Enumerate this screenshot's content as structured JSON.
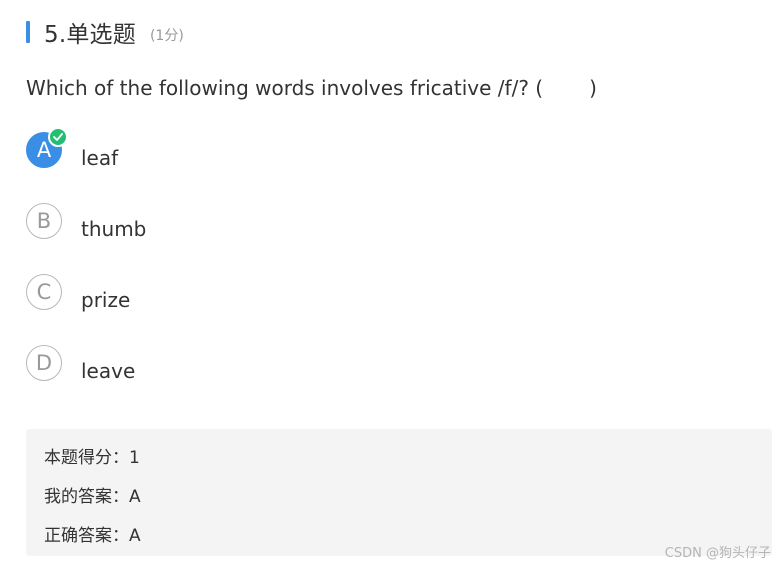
{
  "question": {
    "title": "5.单选题",
    "score_note": "(1分)",
    "text": "Which of the following words involves fricative /f/? (",
    "text_end": ")"
  },
  "options": [
    {
      "letter": "A",
      "text": "leaf",
      "selected": true
    },
    {
      "letter": "B",
      "text": "thumb",
      "selected": false
    },
    {
      "letter": "C",
      "text": "prize",
      "selected": false
    },
    {
      "letter": "D",
      "text": "leave",
      "selected": false
    }
  ],
  "result": {
    "score_label": "本题得分：",
    "score_value": "1",
    "my_answer_label": "我的答案：",
    "my_answer_value": "A",
    "correct_answer_label": "正确答案：",
    "correct_answer_value": "A"
  },
  "watermark": "CSDN @狗头仔子",
  "colors": {
    "accent": "#3a8ee6",
    "correct": "#21bf73"
  },
  "icons": {
    "selected_badge": "check-icon"
  }
}
